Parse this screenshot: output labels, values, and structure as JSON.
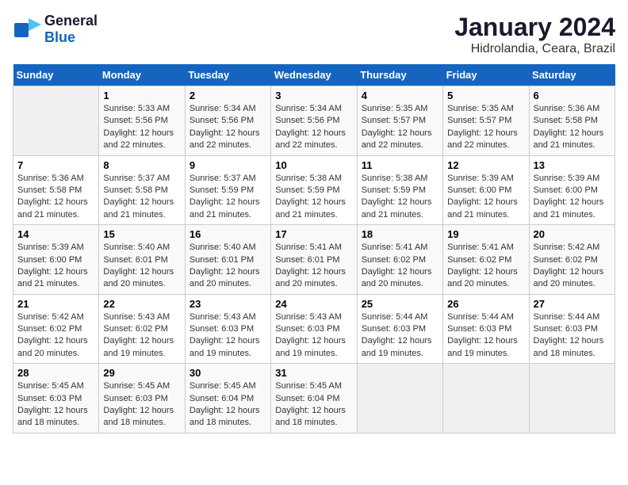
{
  "logo": {
    "line1": "General",
    "line2": "Blue"
  },
  "title": "January 2024",
  "subtitle": "Hidrolandia, Ceara, Brazil",
  "headers": [
    "Sunday",
    "Monday",
    "Tuesday",
    "Wednesday",
    "Thursday",
    "Friday",
    "Saturday"
  ],
  "weeks": [
    [
      {
        "day": "",
        "sunrise": "",
        "sunset": "",
        "daylight": ""
      },
      {
        "day": "1",
        "sunrise": "Sunrise: 5:33 AM",
        "sunset": "Sunset: 5:56 PM",
        "daylight": "Daylight: 12 hours and 22 minutes."
      },
      {
        "day": "2",
        "sunrise": "Sunrise: 5:34 AM",
        "sunset": "Sunset: 5:56 PM",
        "daylight": "Daylight: 12 hours and 22 minutes."
      },
      {
        "day": "3",
        "sunrise": "Sunrise: 5:34 AM",
        "sunset": "Sunset: 5:56 PM",
        "daylight": "Daylight: 12 hours and 22 minutes."
      },
      {
        "day": "4",
        "sunrise": "Sunrise: 5:35 AM",
        "sunset": "Sunset: 5:57 PM",
        "daylight": "Daylight: 12 hours and 22 minutes."
      },
      {
        "day": "5",
        "sunrise": "Sunrise: 5:35 AM",
        "sunset": "Sunset: 5:57 PM",
        "daylight": "Daylight: 12 hours and 22 minutes."
      },
      {
        "day": "6",
        "sunrise": "Sunrise: 5:36 AM",
        "sunset": "Sunset: 5:58 PM",
        "daylight": "Daylight: 12 hours and 21 minutes."
      }
    ],
    [
      {
        "day": "7",
        "sunrise": "Sunrise: 5:36 AM",
        "sunset": "Sunset: 5:58 PM",
        "daylight": "Daylight: 12 hours and 21 minutes."
      },
      {
        "day": "8",
        "sunrise": "Sunrise: 5:37 AM",
        "sunset": "Sunset: 5:58 PM",
        "daylight": "Daylight: 12 hours and 21 minutes."
      },
      {
        "day": "9",
        "sunrise": "Sunrise: 5:37 AM",
        "sunset": "Sunset: 5:59 PM",
        "daylight": "Daylight: 12 hours and 21 minutes."
      },
      {
        "day": "10",
        "sunrise": "Sunrise: 5:38 AM",
        "sunset": "Sunset: 5:59 PM",
        "daylight": "Daylight: 12 hours and 21 minutes."
      },
      {
        "day": "11",
        "sunrise": "Sunrise: 5:38 AM",
        "sunset": "Sunset: 5:59 PM",
        "daylight": "Daylight: 12 hours and 21 minutes."
      },
      {
        "day": "12",
        "sunrise": "Sunrise: 5:39 AM",
        "sunset": "Sunset: 6:00 PM",
        "daylight": "Daylight: 12 hours and 21 minutes."
      },
      {
        "day": "13",
        "sunrise": "Sunrise: 5:39 AM",
        "sunset": "Sunset: 6:00 PM",
        "daylight": "Daylight: 12 hours and 21 minutes."
      }
    ],
    [
      {
        "day": "14",
        "sunrise": "Sunrise: 5:39 AM",
        "sunset": "Sunset: 6:00 PM",
        "daylight": "Daylight: 12 hours and 21 minutes."
      },
      {
        "day": "15",
        "sunrise": "Sunrise: 5:40 AM",
        "sunset": "Sunset: 6:01 PM",
        "daylight": "Daylight: 12 hours and 20 minutes."
      },
      {
        "day": "16",
        "sunrise": "Sunrise: 5:40 AM",
        "sunset": "Sunset: 6:01 PM",
        "daylight": "Daylight: 12 hours and 20 minutes."
      },
      {
        "day": "17",
        "sunrise": "Sunrise: 5:41 AM",
        "sunset": "Sunset: 6:01 PM",
        "daylight": "Daylight: 12 hours and 20 minutes."
      },
      {
        "day": "18",
        "sunrise": "Sunrise: 5:41 AM",
        "sunset": "Sunset: 6:02 PM",
        "daylight": "Daylight: 12 hours and 20 minutes."
      },
      {
        "day": "19",
        "sunrise": "Sunrise: 5:41 AM",
        "sunset": "Sunset: 6:02 PM",
        "daylight": "Daylight: 12 hours and 20 minutes."
      },
      {
        "day": "20",
        "sunrise": "Sunrise: 5:42 AM",
        "sunset": "Sunset: 6:02 PM",
        "daylight": "Daylight: 12 hours and 20 minutes."
      }
    ],
    [
      {
        "day": "21",
        "sunrise": "Sunrise: 5:42 AM",
        "sunset": "Sunset: 6:02 PM",
        "daylight": "Daylight: 12 hours and 20 minutes."
      },
      {
        "day": "22",
        "sunrise": "Sunrise: 5:43 AM",
        "sunset": "Sunset: 6:02 PM",
        "daylight": "Daylight: 12 hours and 19 minutes."
      },
      {
        "day": "23",
        "sunrise": "Sunrise: 5:43 AM",
        "sunset": "Sunset: 6:03 PM",
        "daylight": "Daylight: 12 hours and 19 minutes."
      },
      {
        "day": "24",
        "sunrise": "Sunrise: 5:43 AM",
        "sunset": "Sunset: 6:03 PM",
        "daylight": "Daylight: 12 hours and 19 minutes."
      },
      {
        "day": "25",
        "sunrise": "Sunrise: 5:44 AM",
        "sunset": "Sunset: 6:03 PM",
        "daylight": "Daylight: 12 hours and 19 minutes."
      },
      {
        "day": "26",
        "sunrise": "Sunrise: 5:44 AM",
        "sunset": "Sunset: 6:03 PM",
        "daylight": "Daylight: 12 hours and 19 minutes."
      },
      {
        "day": "27",
        "sunrise": "Sunrise: 5:44 AM",
        "sunset": "Sunset: 6:03 PM",
        "daylight": "Daylight: 12 hours and 18 minutes."
      }
    ],
    [
      {
        "day": "28",
        "sunrise": "Sunrise: 5:45 AM",
        "sunset": "Sunset: 6:03 PM",
        "daylight": "Daylight: 12 hours and 18 minutes."
      },
      {
        "day": "29",
        "sunrise": "Sunrise: 5:45 AM",
        "sunset": "Sunset: 6:03 PM",
        "daylight": "Daylight: 12 hours and 18 minutes."
      },
      {
        "day": "30",
        "sunrise": "Sunrise: 5:45 AM",
        "sunset": "Sunset: 6:04 PM",
        "daylight": "Daylight: 12 hours and 18 minutes."
      },
      {
        "day": "31",
        "sunrise": "Sunrise: 5:45 AM",
        "sunset": "Sunset: 6:04 PM",
        "daylight": "Daylight: 12 hours and 18 minutes."
      },
      {
        "day": "",
        "sunrise": "",
        "sunset": "",
        "daylight": ""
      },
      {
        "day": "",
        "sunrise": "",
        "sunset": "",
        "daylight": ""
      },
      {
        "day": "",
        "sunrise": "",
        "sunset": "",
        "daylight": ""
      }
    ]
  ]
}
